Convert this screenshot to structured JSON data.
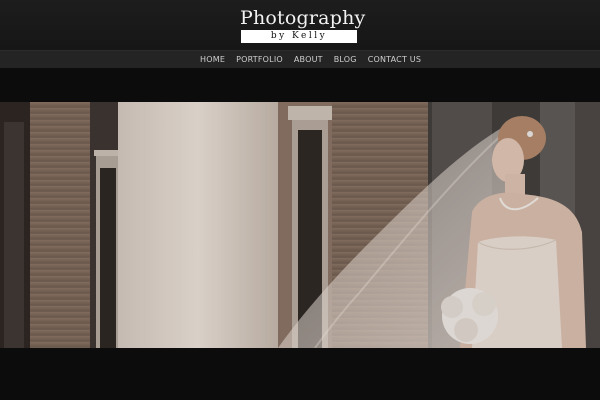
{
  "site": {
    "logo_title": "Photography",
    "logo_subtitle": "by Kelly"
  },
  "nav": {
    "items": [
      {
        "label": "HOME"
      },
      {
        "label": "PORTFOLIO"
      },
      {
        "label": "ABOUT"
      },
      {
        "label": "BLOG"
      },
      {
        "label": "CONTACT US"
      }
    ]
  },
  "hero": {
    "image": "bride-with-veil-photo"
  },
  "colors": {
    "background": "#0c0c0c",
    "header": "#1a1a1a",
    "nav_bar": "#242424",
    "nav_text": "#cfcfcf",
    "logo_text": "#f2f2f2"
  }
}
